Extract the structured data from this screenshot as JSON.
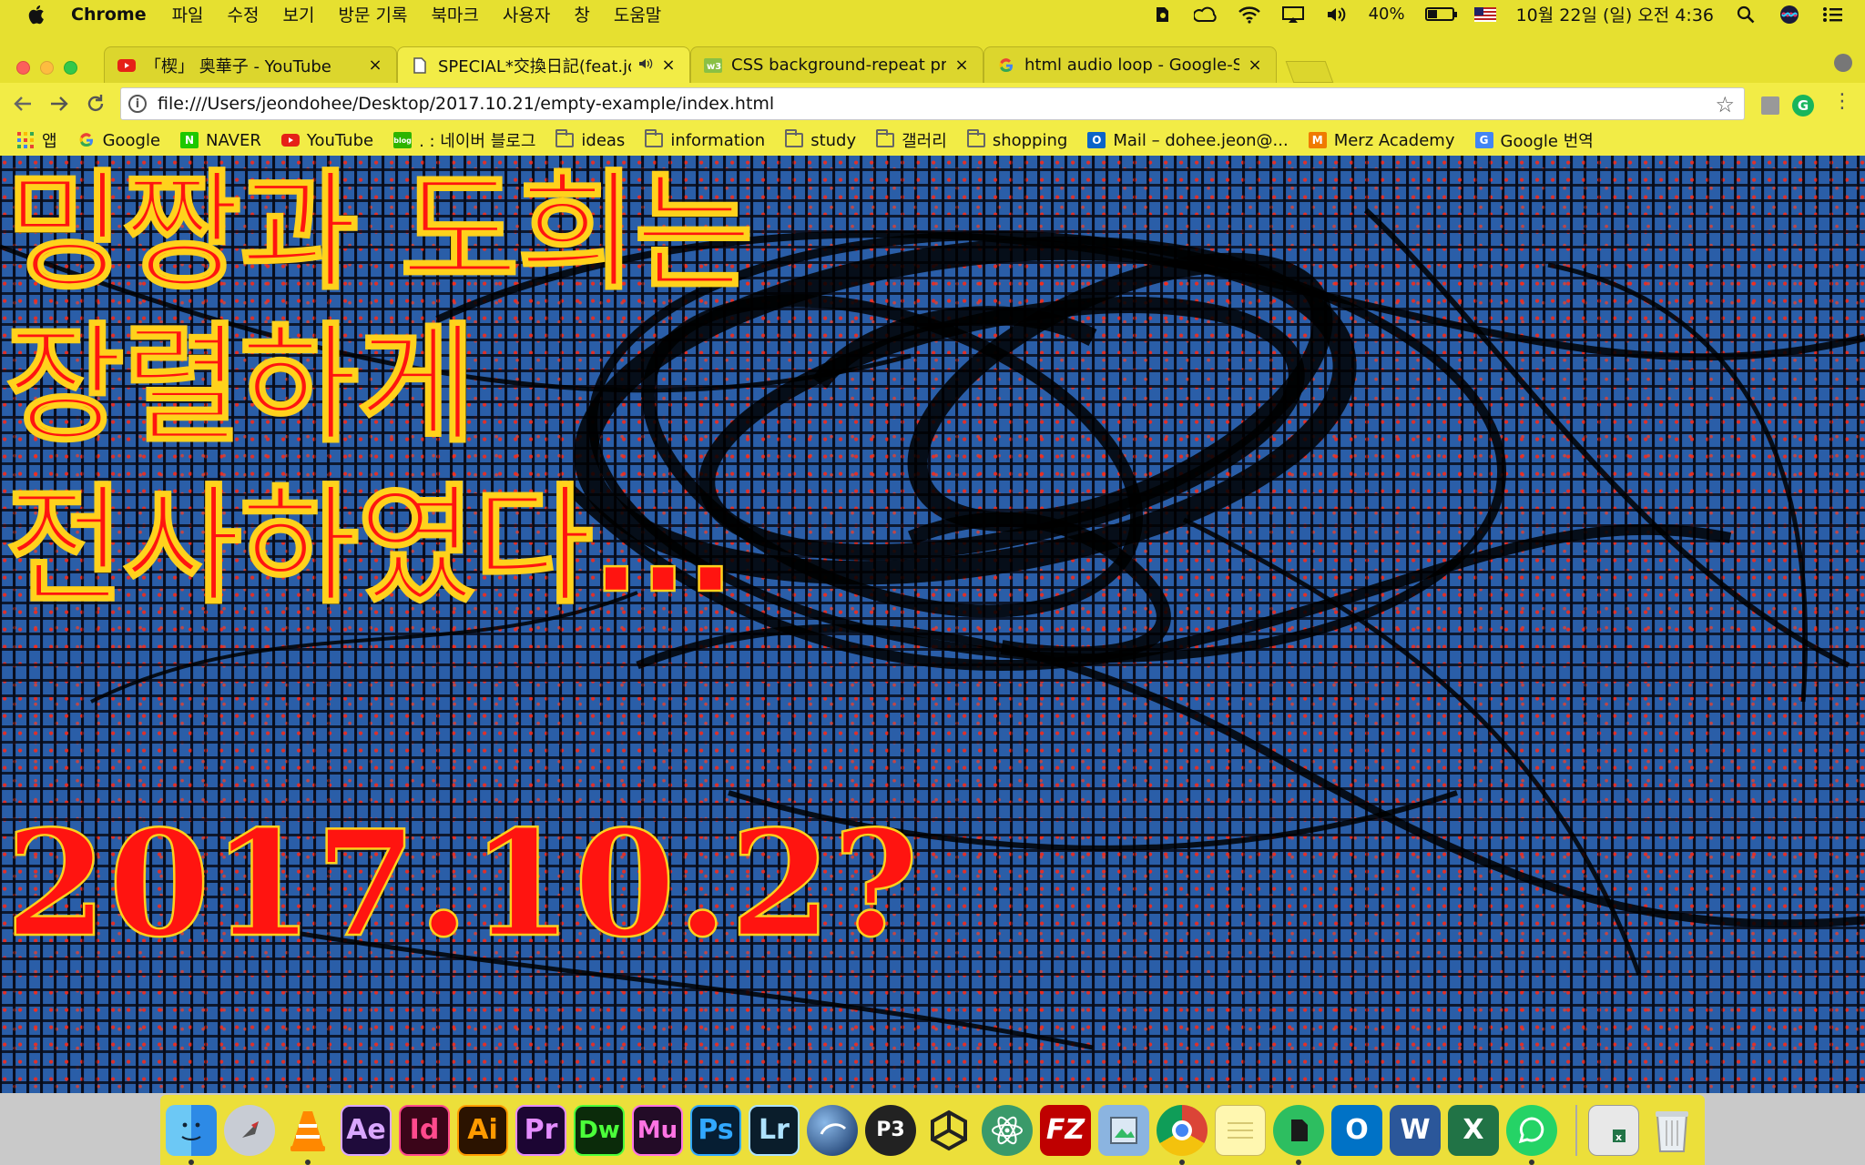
{
  "menubar": {
    "app_name": "Chrome",
    "menus": [
      "파일",
      "수정",
      "보기",
      "방문 기록",
      "북마크",
      "사용자",
      "창",
      "도움말"
    ],
    "battery_percent": "40%",
    "battery_level": 0.4,
    "datetime": "10월 22일 (일) 오전 4:36",
    "status_icons": [
      "evernote-icon",
      "creative-cloud-icon",
      "wifi-icon",
      "airplay-icon",
      "volume-icon",
      "battery-icon",
      "us-flag-icon",
      "spotlight-icon",
      "siri-icon",
      "notification-center-icon"
    ]
  },
  "tabs": [
    {
      "title": "「楔」 奥華子 - YouTube",
      "favicon": "youtube-icon",
      "active": false
    },
    {
      "title": "SPECIAL*交換日記(feat.joie)",
      "favicon": "document-icon",
      "active": true,
      "audio": true
    },
    {
      "title": "CSS background-repeat prope",
      "favicon": "w3schools-icon",
      "active": false
    },
    {
      "title": "html audio loop - Google-Such",
      "favicon": "google-icon",
      "active": false
    }
  ],
  "toolbar": {
    "url": "file:///Users/jeondohee/Desktop/2017.10.21/empty-example/index.html"
  },
  "bookmarks": [
    {
      "label": "앱",
      "icon": "apps-grid-icon"
    },
    {
      "label": "Google",
      "icon": "google-icon"
    },
    {
      "label": "NAVER",
      "icon": "naver-icon"
    },
    {
      "label": "YouTube",
      "icon": "youtube-icon"
    },
    {
      "label": ". : 네이버 블로그",
      "icon": "naver-blog-icon"
    },
    {
      "label": "ideas",
      "icon": "folder-icon"
    },
    {
      "label": "information",
      "icon": "folder-icon"
    },
    {
      "label": "study",
      "icon": "folder-icon"
    },
    {
      "label": "갤러리",
      "icon": "folder-icon"
    },
    {
      "label": "shopping",
      "icon": "folder-icon"
    },
    {
      "label": "Mail – dohee.jeon@...",
      "icon": "outlook-icon"
    },
    {
      "label": "Merz Academy",
      "icon": "merz-icon"
    },
    {
      "label": "Google 번역",
      "icon": "google-translate-icon"
    }
  ],
  "page": {
    "line1": "밍짱과 도희는",
    "line2": "장렬하게",
    "line3": "전사하였다...",
    "date": "2017.10.2?"
  },
  "dock": {
    "apps": [
      {
        "name": "finder-icon",
        "label": ""
      },
      {
        "name": "launchpad-icon",
        "label": ""
      },
      {
        "name": "vlc-icon",
        "label": ""
      },
      {
        "name": "after-effects-icon",
        "label": "Ae"
      },
      {
        "name": "indesign-icon",
        "label": "Id"
      },
      {
        "name": "illustrator-icon",
        "label": "Ai"
      },
      {
        "name": "premiere-icon",
        "label": "Pr"
      },
      {
        "name": "dreamweaver-icon",
        "label": "Dw"
      },
      {
        "name": "muse-icon",
        "label": "Mu"
      },
      {
        "name": "photoshop-icon",
        "label": "Ps"
      },
      {
        "name": "lightroom-icon",
        "label": "Lr"
      },
      {
        "name": "cinema4d-icon",
        "label": ""
      },
      {
        "name": "p3-icon",
        "label": "P3"
      },
      {
        "name": "unity-icon",
        "label": ""
      },
      {
        "name": "atom-icon",
        "label": ""
      },
      {
        "name": "filezilla-icon",
        "label": "FZ"
      },
      {
        "name": "preview-icon",
        "label": ""
      },
      {
        "name": "chrome-icon",
        "label": ""
      },
      {
        "name": "notes-icon",
        "label": ""
      },
      {
        "name": "evernote-icon",
        "label": ""
      },
      {
        "name": "outlook-icon",
        "label": "O"
      },
      {
        "name": "word-icon",
        "label": "W"
      },
      {
        "name": "excel-icon",
        "label": "X"
      },
      {
        "name": "whatsapp-icon",
        "label": ""
      },
      {
        "name": "excel-file-icon",
        "label": ""
      },
      {
        "name": "trash-icon",
        "label": ""
      }
    ]
  },
  "colors": {
    "chrome_yellow": "#e6e030",
    "title_red": "#ff1410",
    "title_outline": "#ffd21c",
    "pattern_blue": "#2a5ea8"
  }
}
